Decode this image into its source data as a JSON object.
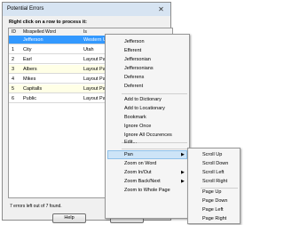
{
  "dialog": {
    "title": "Potential Errors",
    "close_glyph": "✕",
    "instruction": "Right click on a row to process it:",
    "columns": [
      "ID",
      "Misspelled Word",
      "Is"
    ],
    "rows": [
      {
        "id": "",
        "word": "Jefferson",
        "is": "Western USA",
        "selected": true
      },
      {
        "id": "1",
        "word": "City",
        "is": "Utah"
      },
      {
        "id": "2",
        "word": "Earl",
        "is": "Layout Page"
      },
      {
        "id": "3",
        "word": "Albers",
        "is": "Layout Page"
      },
      {
        "id": "4",
        "word": "Mikes",
        "is": "Layout Page"
      },
      {
        "id": "5",
        "word": "Capitalls",
        "is": "Layout Page"
      },
      {
        "id": "6",
        "word": "Public",
        "is": "Layout Page"
      }
    ],
    "status": "7 errors left out of 7 found.",
    "help_label": "Help",
    "close_label": "Cl"
  },
  "context_menu": {
    "suggestions": [
      "Jefferson",
      "Efferent",
      "Jeffersonian",
      "Jeffersonians",
      "Deferens",
      "Deferent"
    ],
    "actions": [
      "Add to Dictionary",
      "Add to Locationary",
      "Bookmark",
      "Ignore Once",
      "Ignore All Occurences"
    ],
    "edit": "Edit...",
    "nav": [
      "Pan",
      "Zoom on Word",
      "Zoom In/Out",
      "Zoom Back/Next",
      "Zoom to Whole Page"
    ]
  },
  "pan_submenu": {
    "items": [
      "Scroll Up",
      "Scroll Down",
      "Scroll Left",
      "Scroll Right",
      "Page Up",
      "Page Down",
      "Page Left",
      "Page Right"
    ]
  },
  "colors": {
    "selection": "#3399ff",
    "highlight": "#cde4f7"
  }
}
